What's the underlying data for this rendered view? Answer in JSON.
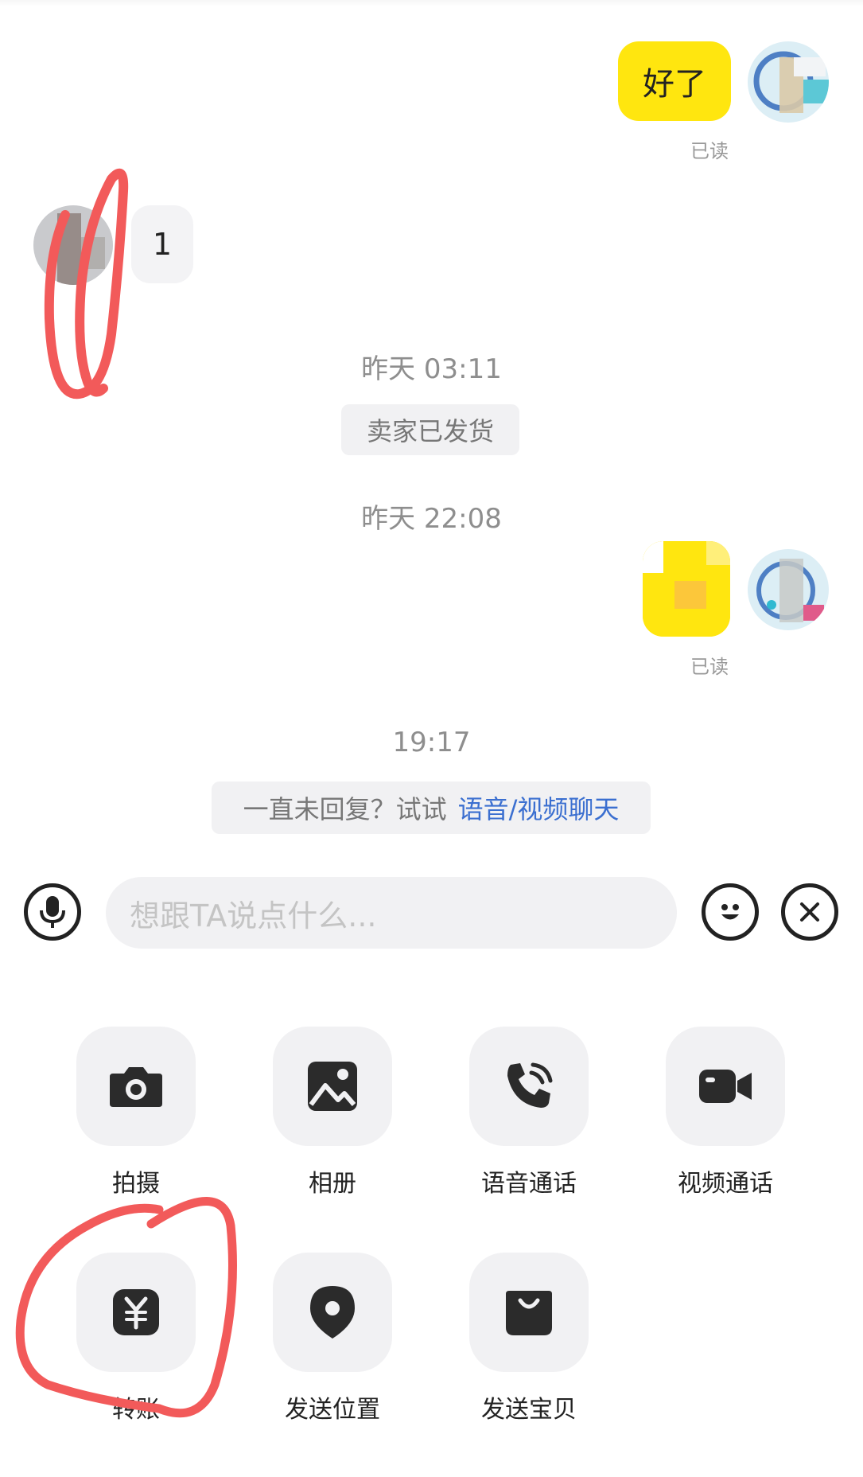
{
  "messages": [
    {
      "side": "me",
      "text": "好了",
      "status": "已读"
    },
    {
      "side": "other",
      "text": "1"
    },
    {
      "side": "me",
      "text": "",
      "status": "已读"
    }
  ],
  "timestamps": [
    "昨天 03:11",
    "昨天 22:08",
    "19:17"
  ],
  "system_notices": {
    "shipped": "卖家已发货",
    "no_reply_prefix": "一直未回复？试试",
    "no_reply_link": "语音/视频聊天"
  },
  "composer": {
    "placeholder": "想跟TA说点什么..."
  },
  "tools": [
    {
      "label": "拍摄",
      "icon": "camera-icon"
    },
    {
      "label": "相册",
      "icon": "photo-album-icon"
    },
    {
      "label": "语音通话",
      "icon": "voice-call-icon"
    },
    {
      "label": "视频通话",
      "icon": "video-call-icon"
    },
    {
      "label": "转账",
      "icon": "yuan-transfer-icon"
    },
    {
      "label": "发送位置",
      "icon": "location-pin-icon"
    },
    {
      "label": "发送宝贝",
      "icon": "shopping-bag-icon"
    }
  ],
  "colors": {
    "my_bubble": "#ffe60f",
    "other_bubble": "#f3f3f5",
    "link": "#3b6fd0",
    "annotation": "#f25a5a"
  }
}
